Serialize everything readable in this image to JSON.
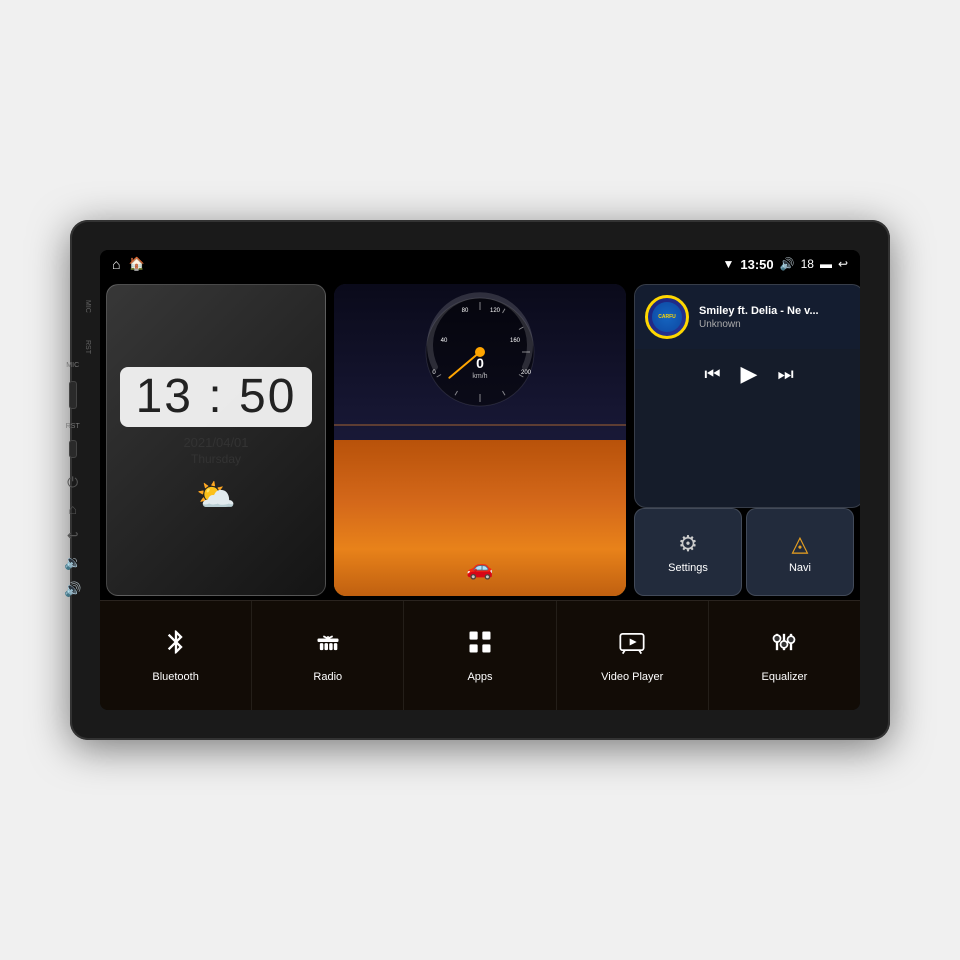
{
  "device": {
    "background_color": "#1a1a1a"
  },
  "status_bar": {
    "time": "13:50",
    "volume": "18",
    "wifi_icon": "▼",
    "volume_icon": "🔊",
    "battery_icon": "▬",
    "back_icon": "↩",
    "home_icon": "⌂",
    "widget_icon": "⊞"
  },
  "clock_widget": {
    "time": "13 : 50",
    "date": "2021/04/01",
    "day": "Thursday",
    "weather_icon": "⛅"
  },
  "speedometer": {
    "speed": "0",
    "unit": "km/h"
  },
  "music": {
    "title": "Smiley ft. Delia - Ne v...",
    "artist": "Unknown",
    "prev_icon": "⏮",
    "play_icon": "▶",
    "next_icon": "⏭",
    "logo_text": "CARFU"
  },
  "quick_buttons": {
    "settings": {
      "label": "Settings",
      "icon": "⚙"
    },
    "navi": {
      "label": "Navi",
      "icon": "◬"
    }
  },
  "apps": [
    {
      "id": "bluetooth",
      "label": "Bluetooth",
      "icon": "bluetooth"
    },
    {
      "id": "radio",
      "label": "Radio",
      "icon": "radio"
    },
    {
      "id": "apps",
      "label": "Apps",
      "icon": "apps"
    },
    {
      "id": "video-player",
      "label": "Video Player",
      "icon": "video"
    },
    {
      "id": "equalizer",
      "label": "Equalizer",
      "icon": "equalizer"
    }
  ],
  "side_labels": {
    "mic": "MIC",
    "rst": "RST"
  }
}
